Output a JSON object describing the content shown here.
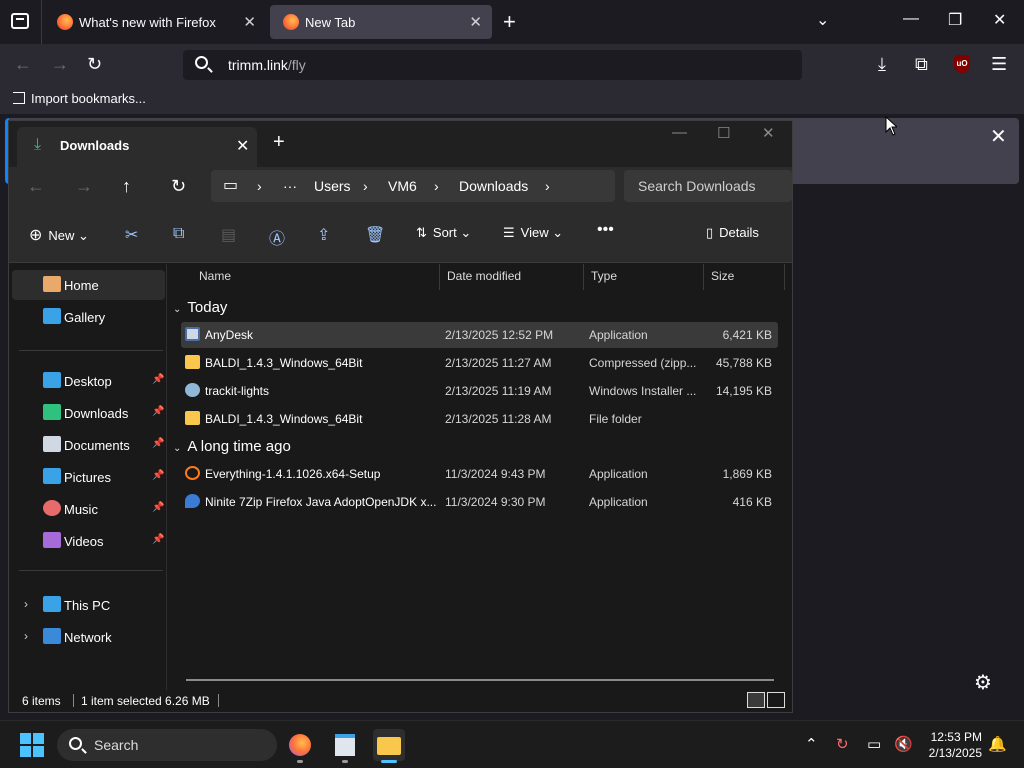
{
  "firefox": {
    "tabs": [
      {
        "label": "What's new with Firefox"
      },
      {
        "label": "New Tab"
      }
    ],
    "url_host": "trimm.link",
    "url_path": "/fly",
    "bookmarks": {
      "import_label": "Import bookmarks..."
    }
  },
  "explorer": {
    "tab_title": "Downloads",
    "breadcrumb": [
      "···",
      "Users",
      "VM6",
      "Downloads"
    ],
    "search_placeholder": "Search Downloads",
    "toolbar": {
      "new_label": "New",
      "sort_label": "Sort",
      "view_label": "View",
      "details_label": "Details"
    },
    "sidebar": {
      "top": [
        {
          "label": "Home",
          "icon": "home-icon",
          "active": true
        },
        {
          "label": "Gallery",
          "icon": "gallery-icon"
        }
      ],
      "pinned": [
        {
          "label": "Desktop",
          "icon": "desktop-icon"
        },
        {
          "label": "Downloads",
          "icon": "downloads-icon"
        },
        {
          "label": "Documents",
          "icon": "documents-icon"
        },
        {
          "label": "Pictures",
          "icon": "pictures-icon"
        },
        {
          "label": "Music",
          "icon": "music-icon"
        },
        {
          "label": "Videos",
          "icon": "videos-icon"
        }
      ],
      "tree": [
        {
          "label": "This PC",
          "icon": "this-pc-icon"
        },
        {
          "label": "Network",
          "icon": "network-icon"
        }
      ]
    },
    "columns": {
      "name": "Name",
      "date": "Date modified",
      "type": "Type",
      "size": "Size"
    },
    "groups": [
      {
        "label": "Today",
        "files": [
          {
            "name": "AnyDesk",
            "date": "2/13/2025 12:52 PM",
            "type": "Application",
            "size": "6,421 KB",
            "icon": "application-icon",
            "selected": true
          },
          {
            "name": "BALDI_1.4.3_Windows_64Bit",
            "date": "2/13/2025 11:27 AM",
            "type": "Compressed (zipp...",
            "size": "45,788 KB",
            "icon": "zip-folder-icon"
          },
          {
            "name": "trackit-lights",
            "date": "2/13/2025 11:19 AM",
            "type": "Windows Installer ...",
            "size": "14,195 KB",
            "icon": "installer-icon"
          },
          {
            "name": "BALDI_1.4.3_Windows_64Bit",
            "date": "2/13/2025 11:28 AM",
            "type": "File folder",
            "size": "",
            "icon": "folder-icon"
          }
        ]
      },
      {
        "label": "A long time ago",
        "files": [
          {
            "name": "Everything-1.4.1.1026.x64-Setup",
            "date": "11/3/2024 9:43 PM",
            "type": "Application",
            "size": "1,869 KB",
            "icon": "search-app-icon"
          },
          {
            "name": "Ninite 7Zip Firefox Java AdoptOpenJDK x...",
            "date": "11/3/2024 9:30 PM",
            "type": "Application",
            "size": "416 KB",
            "icon": "ninite-icon"
          }
        ]
      }
    ],
    "status": {
      "items": "6 items",
      "selected": "1 item selected  6.26 MB"
    }
  },
  "taskbar": {
    "search_label": "Search",
    "clock_time": "12:53 PM",
    "clock_date": "2/13/2025"
  },
  "colors": {
    "accent": "#4cc2ff",
    "folder": "#f8c74b",
    "ff_blue": "#0a84ff"
  }
}
